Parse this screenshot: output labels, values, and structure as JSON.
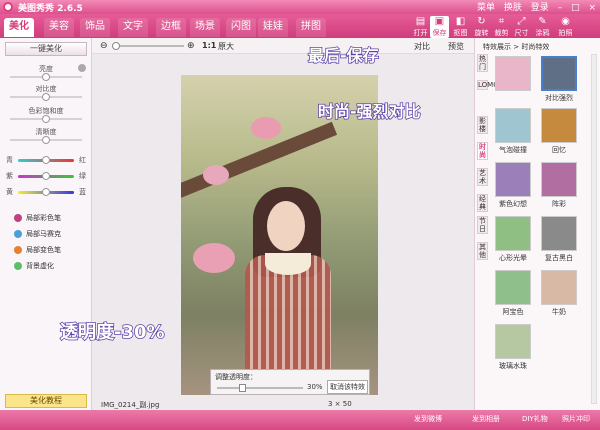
{
  "app": {
    "title": "美图秀秀 2.6.5",
    "window_controls": [
      "菜单",
      "换肤",
      "登录"
    ]
  },
  "tabs": [
    {
      "label": "美化"
    },
    {
      "label": "美容"
    },
    {
      "label": "饰品"
    },
    {
      "label": "文字"
    },
    {
      "label": "边框"
    },
    {
      "label": "场景"
    },
    {
      "label": "闪图"
    },
    {
      "label": "娃娃"
    },
    {
      "label": "拼图"
    }
  ],
  "toolbar": [
    {
      "label": "打开",
      "icon": "open-icon"
    },
    {
      "label": "保存",
      "icon": "save-icon"
    },
    {
      "label": "抠图",
      "icon": "cutout-icon"
    },
    {
      "label": "旋转",
      "icon": "rotate-icon"
    },
    {
      "label": "裁剪",
      "icon": "crop-icon"
    },
    {
      "label": "尺寸",
      "icon": "resize-icon"
    },
    {
      "label": "涂鸦",
      "icon": "brush-icon"
    },
    {
      "label": "拍照",
      "icon": "camera-icon"
    }
  ],
  "sidebar": {
    "one_click": "一键美化",
    "sliders": [
      {
        "label": "亮度",
        "value": 0.5
      },
      {
        "label": "对比度",
        "value": 0.5
      },
      {
        "label": "色彩饱和度",
        "value": 0.5
      },
      {
        "label": "清晰度",
        "value": 0.5
      }
    ],
    "color_balance": [
      {
        "left": "青",
        "right": "红",
        "value": 0.5
      },
      {
        "left": "紫",
        "right": "绿",
        "value": 0.5
      },
      {
        "left": "黄",
        "right": "蓝",
        "value": 0.5
      }
    ],
    "tools": [
      {
        "label": "局部彩色笔",
        "color": "#c04080"
      },
      {
        "label": "局部马赛克",
        "color": "#4aa0d8"
      },
      {
        "label": "局部变色笔",
        "color": "#e88030"
      },
      {
        "label": "背景虚化",
        "color": "#5bbf6a"
      }
    ],
    "tutorial": "美化教程"
  },
  "canvas": {
    "zoom": "1:1",
    "original_label": "原大",
    "compare_label": "对比",
    "preview_label": "预览",
    "filename": "IMG_0214_副.jpg",
    "transparency": {
      "label": "调整透明度：",
      "value_text": "30%",
      "value": 0.3,
      "cancel": "取消该特效"
    },
    "size_text": "3 × 50"
  },
  "effects": {
    "breadcrumb": "特效展示 > 时尚特效",
    "categories": [
      "热门",
      "LOMO",
      "影楼",
      "时尚",
      "艺术",
      "经典",
      "节日",
      "其他"
    ],
    "active_category": "时尚",
    "items": [
      {
        "label": "",
        "color": "#e8b6c8",
        "selected": false
      },
      {
        "label": "对比强烈",
        "color": "#5e6f86",
        "selected": true
      },
      {
        "label": "气泡碰撞",
        "color": "#9fc6d0",
        "selected": false
      },
      {
        "label": "回忆",
        "color": "#c58a3e",
        "selected": false
      },
      {
        "label": "紫色幻想",
        "color": "#9a7fb8",
        "selected": false
      },
      {
        "label": "阵彩",
        "color": "#b06fa0",
        "selected": false
      },
      {
        "label": "心形光晕",
        "color": "#8fbf82",
        "selected": false
      },
      {
        "label": "复古黑白",
        "color": "#8a8a8a",
        "selected": false
      },
      {
        "label": "阿宝色",
        "color": "#8fbf8a",
        "selected": false
      },
      {
        "label": "牛奶",
        "color": "#d8b9a5",
        "selected": false
      },
      {
        "label": "玻璃水珠",
        "color": "#b5c8a2",
        "selected": false
      }
    ]
  },
  "statusbar": {
    "items": [
      "发到微博",
      "发到相册",
      "DIY礼物",
      "照片冲印"
    ]
  },
  "annotations": [
    "最后-保存",
    "时尚-强烈对比",
    "透明度-30%"
  ],
  "colors": {
    "brand": "#d84382",
    "annotation_stroke": "#5b3fa6"
  }
}
